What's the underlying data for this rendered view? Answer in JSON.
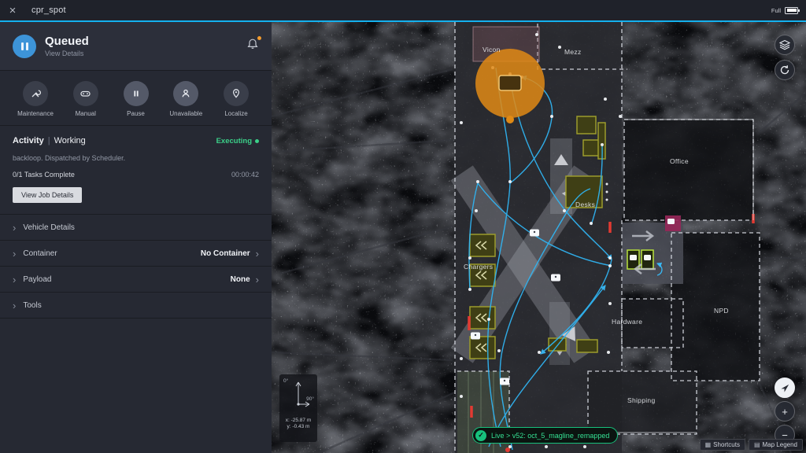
{
  "topbar": {
    "title": "cpr_spot",
    "battery": "Full"
  },
  "icons": {
    "close": "×",
    "chevron": "›",
    "plus": "+",
    "minus": "−",
    "keyboard": "▦",
    "map": "▤",
    "check": "✓"
  },
  "sidebar": {
    "header": {
      "title": "Queued",
      "subtitle": "View Details"
    },
    "actions": [
      {
        "label": "Maintenance"
      },
      {
        "label": "Manual"
      },
      {
        "label": "Pause"
      },
      {
        "label": "Unavailable"
      },
      {
        "label": "Localize"
      }
    ],
    "activity": {
      "title": "Activity",
      "separator": "|",
      "state": "Working",
      "status": "Executing",
      "description": "backloop. Dispatched by Scheduler.",
      "tasks": "0/1 Tasks Complete",
      "elapsed": "00:00:42",
      "job_button": "View Job Details"
    },
    "sections": [
      {
        "label": "Vehicle Details",
        "value": ""
      },
      {
        "label": "Container",
        "value": "No Container"
      },
      {
        "label": "Payload",
        "value": "None"
      },
      {
        "label": "Tools",
        "value": ""
      }
    ]
  },
  "map": {
    "labels": {
      "vicon": "Vicon",
      "mezz": "Mezz",
      "office": "Office",
      "desks": "Desks",
      "chargers": "Chargers",
      "hardware": "Hardware",
      "npd": "NPD",
      "shipping": "Shipping"
    },
    "live_badge": "Live > v52: oct_5_magline_remapped",
    "shortcuts": "Shortcuts",
    "legend": "Map Legend",
    "compass": {
      "deg0": "0°",
      "deg90": "90°",
      "x": "x: -25.87 m",
      "y": "y: -0.43 m"
    }
  }
}
